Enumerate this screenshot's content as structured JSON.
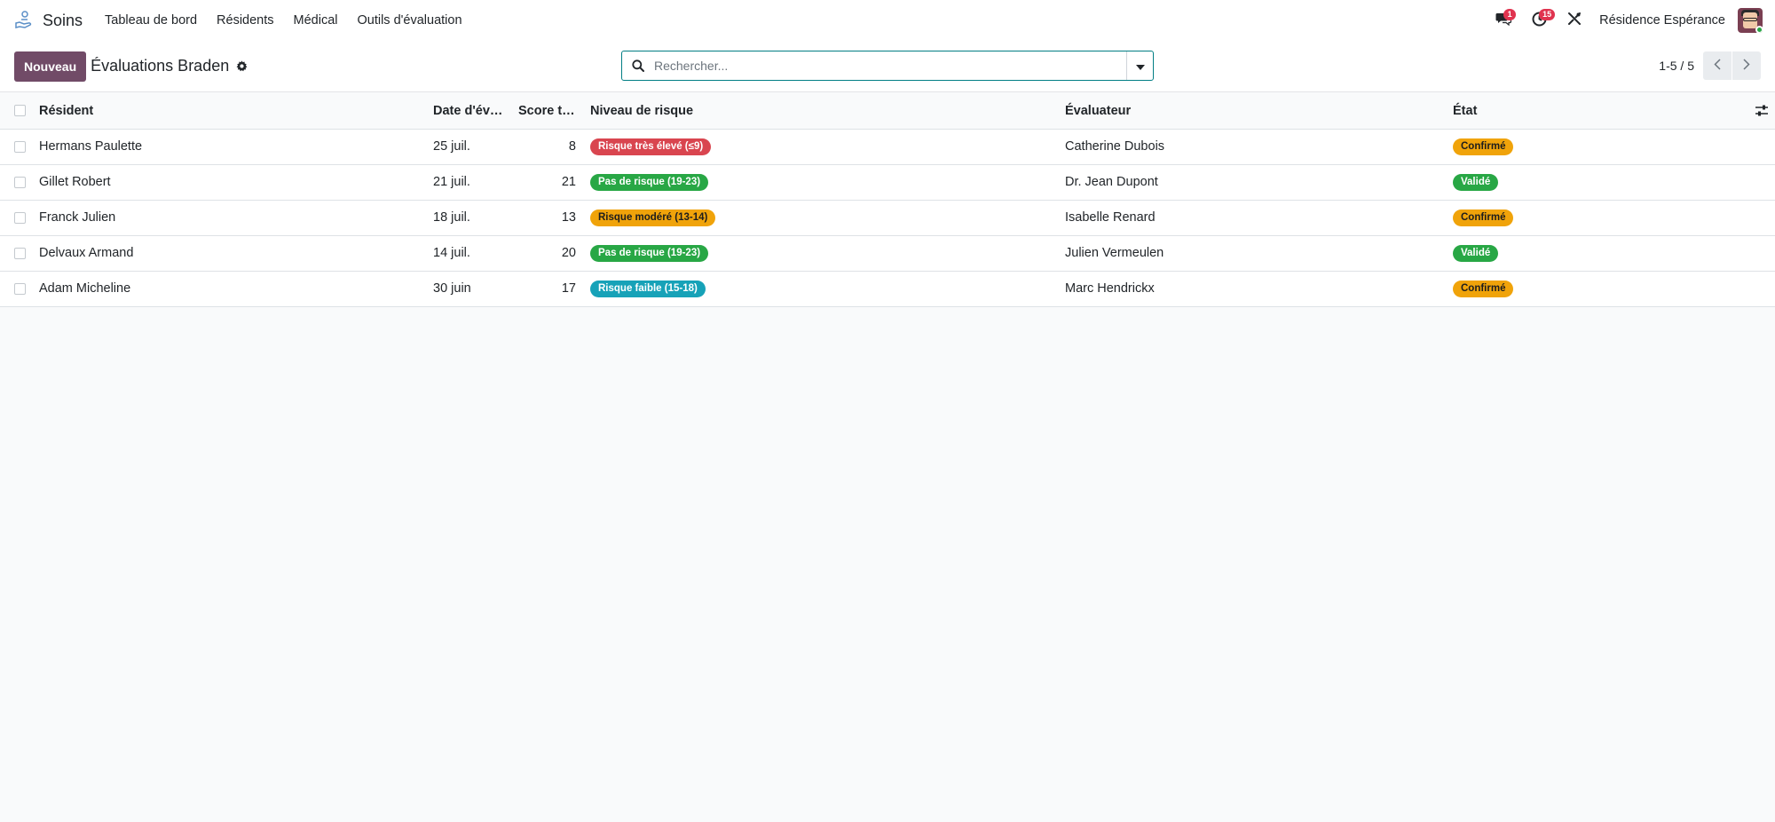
{
  "app": {
    "name": "Soins",
    "menu": [
      "Tableau de bord",
      "Résidents",
      "Médical",
      "Outils d'évaluation"
    ],
    "messages_count": "1",
    "activities_count": "15",
    "company": "Résidence Espérance"
  },
  "control": {
    "new_label": "Nouveau",
    "title": "Évaluations Braden",
    "search_placeholder": "Rechercher...",
    "pager": "1-5 / 5"
  },
  "table": {
    "headers": {
      "resident": "Résident",
      "date": "Date d'éval...",
      "score": "Score tot...",
      "risk": "Niveau de risque",
      "evaluator": "Évaluateur",
      "state": "État"
    },
    "rows": [
      {
        "resident": "Hermans Paulette",
        "date": "25 juil.",
        "score": "8",
        "risk": "Risque très élevé (≤9)",
        "risk_color": "#d9454f",
        "risk_text": "#ffffff",
        "evaluator": "Catherine Dubois",
        "state": "Confirmé",
        "state_color": "#f0a30a",
        "state_text": "#1d1d1d"
      },
      {
        "resident": "Gillet Robert",
        "date": "21 juil.",
        "score": "21",
        "risk": "Pas de risque (19-23)",
        "risk_color": "#28a745",
        "risk_text": "#ffffff",
        "evaluator": "Dr. Jean Dupont",
        "state": "Validé",
        "state_color": "#28a745",
        "state_text": "#ffffff"
      },
      {
        "resident": "Franck Julien",
        "date": "18 juil.",
        "score": "13",
        "risk": "Risque modéré (13-14)",
        "risk_color": "#f0a30a",
        "risk_text": "#1d1d1d",
        "evaluator": "Isabelle Renard",
        "state": "Confirmé",
        "state_color": "#f0a30a",
        "state_text": "#1d1d1d"
      },
      {
        "resident": "Delvaux Armand",
        "date": "14 juil.",
        "score": "20",
        "risk": "Pas de risque (19-23)",
        "risk_color": "#28a745",
        "risk_text": "#ffffff",
        "evaluator": "Julien Vermeulen",
        "state": "Validé",
        "state_color": "#28a745",
        "state_text": "#ffffff"
      },
      {
        "resident": "Adam Micheline",
        "date": "30 juin",
        "score": "17",
        "risk": "Risque faible (15-18)",
        "risk_color": "#17a2b8",
        "risk_text": "#ffffff",
        "evaluator": "Marc Hendrickx",
        "state": "Confirmé",
        "state_color": "#f0a30a",
        "state_text": "#1d1d1d"
      }
    ]
  },
  "colors": {
    "primary": "#714b67",
    "accent": "#017e84"
  }
}
